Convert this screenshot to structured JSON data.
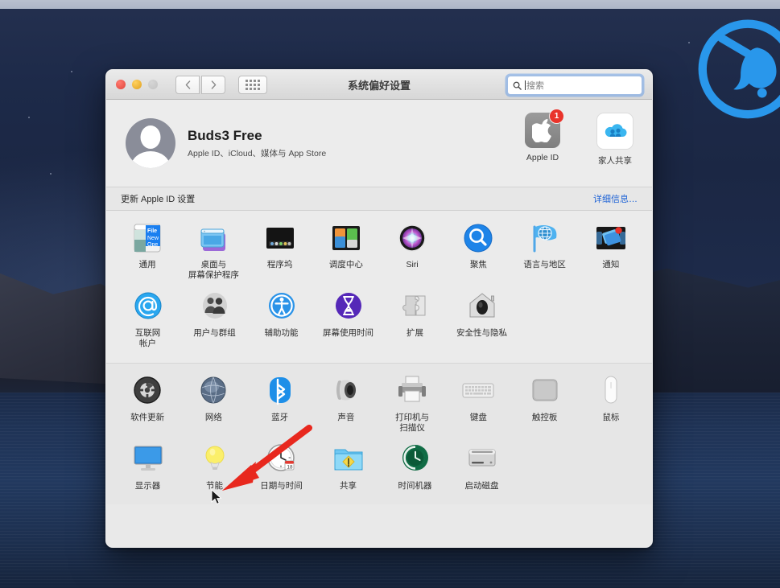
{
  "desktop": {
    "wallpaper_name": "catalina-night-island",
    "watermark_icon": "blue-circular-logo"
  },
  "window": {
    "title": "系统偏好设置",
    "traffic_lights": [
      {
        "name": "close",
        "color": "#e0443b"
      },
      {
        "name": "minimize",
        "color": "#e0a020"
      },
      {
        "name": "zoom",
        "color": "#c2c2c2"
      }
    ],
    "nav": {
      "back": "‹",
      "forward": "›"
    },
    "grid_button_icon": "grid-dots-icon",
    "search": {
      "placeholder": "搜索",
      "value": "",
      "icon": "search-icon"
    }
  },
  "account": {
    "name": "Buds3 Free",
    "subtitle": "Apple ID、iCloud、媒体与 App Store",
    "avatar_icon": "person-avatar",
    "tiles": [
      {
        "label": "Apple ID",
        "icon": "apple-logo-icon",
        "badge": "1"
      },
      {
        "label": "家人共享",
        "icon": "family-sharing-cloud-icon",
        "badge": ""
      }
    ]
  },
  "banner": {
    "text": "更新 Apple ID 设置",
    "link": "详细信息…",
    "link_color": "#1d62d6"
  },
  "sections": [
    {
      "rows": [
        [
          {
            "label": "通用",
            "icon": "general-window-icon"
          },
          {
            "label": "桌面与\n屏幕保护程序",
            "icon": "desktop-screensaver-icon"
          },
          {
            "label": "程序坞",
            "icon": "dock-icon"
          },
          {
            "label": "调度中心",
            "icon": "mission-control-icon"
          },
          {
            "label": "Siri",
            "icon": "siri-icon"
          },
          {
            "label": "聚焦",
            "icon": "spotlight-icon"
          },
          {
            "label": "语言与地区",
            "icon": "language-region-flag-icon"
          },
          {
            "label": "通知",
            "icon": "notifications-icon"
          }
        ],
        [
          {
            "label": "互联网\n帐户",
            "icon": "internet-accounts-at-icon"
          },
          {
            "label": "用户与群组",
            "icon": "users-groups-icon"
          },
          {
            "label": "辅助功能",
            "icon": "accessibility-icon"
          },
          {
            "label": "屏幕使用时间",
            "icon": "screen-time-hourglass-icon"
          },
          {
            "label": "扩展",
            "icon": "extensions-puzzle-icon"
          },
          {
            "label": "安全性与隐私",
            "icon": "security-privacy-house-icon"
          }
        ]
      ]
    },
    {
      "rows": [
        [
          {
            "label": "软件更新",
            "icon": "software-update-gear-icon"
          },
          {
            "label": "网络",
            "icon": "network-globe-icon"
          },
          {
            "label": "蓝牙",
            "icon": "bluetooth-icon"
          },
          {
            "label": "声音",
            "icon": "sound-speaker-icon"
          },
          {
            "label": "打印机与\n扫描仪",
            "icon": "printers-scanners-icon"
          },
          {
            "label": "键盘",
            "icon": "keyboard-icon"
          },
          {
            "label": "触控板",
            "icon": "trackpad-icon"
          },
          {
            "label": "鼠标",
            "icon": "mouse-icon"
          }
        ],
        [
          {
            "label": "显示器",
            "icon": "displays-monitor-icon"
          },
          {
            "label": "节能",
            "icon": "energy-saver-bulb-icon"
          },
          {
            "label": "日期与时间",
            "icon": "date-time-clock-icon"
          },
          {
            "label": "共享",
            "icon": "sharing-folder-icon"
          },
          {
            "label": "时间机器",
            "icon": "time-machine-icon"
          },
          {
            "label": "启动磁盘",
            "icon": "startup-disk-icon"
          }
        ]
      ]
    }
  ],
  "annotation": {
    "arrow_color": "#e8281e",
    "arrow_target": "节能",
    "cursor_icon": "arrow-pointer"
  }
}
